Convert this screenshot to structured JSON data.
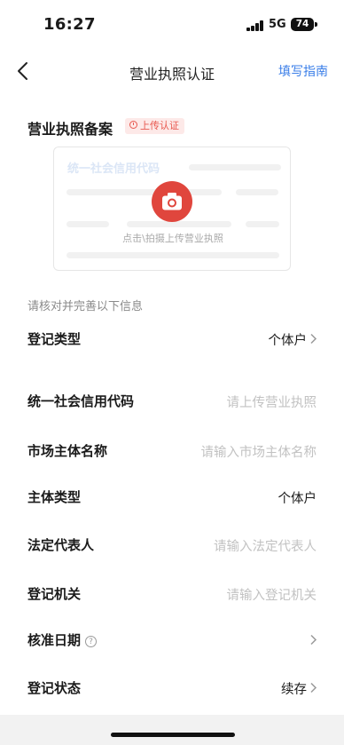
{
  "status_bar": {
    "time": "16:27",
    "network": "5G",
    "battery": "74"
  },
  "nav": {
    "title": "营业执照认证",
    "guide": "填写指南"
  },
  "license": {
    "title": "营业执照备案",
    "badge": "上传认证",
    "card_ghost_title": "统一社会信用代码",
    "card_hint": "点击\\拍摄上传营业执照"
  },
  "info_caption": "请核对并完善以下信息",
  "form": {
    "register_type": {
      "label": "登记类型",
      "value": "个体户"
    },
    "credit_code": {
      "label": "统一社会信用代码",
      "placeholder": "请上传营业执照"
    },
    "entity_name": {
      "label": "市场主体名称",
      "placeholder": "请输入市场主体名称"
    },
    "entity_type": {
      "label": "主体类型",
      "value": "个体户"
    },
    "legal_rep": {
      "label": "法定代表人",
      "placeholder": "请输入法定代表人"
    },
    "authority": {
      "label": "登记机关",
      "placeholder": "请输入登记机关"
    },
    "approval_date": {
      "label": "核准日期",
      "help": "?"
    },
    "register_status": {
      "label": "登记状态",
      "value": "续存"
    }
  },
  "colors": {
    "accent": "#3a7ee8",
    "camera": "#e0463d",
    "badge_text": "#e8584f",
    "badge_bg": "#fde9e8"
  },
  "icons": [
    "back-icon",
    "camera-icon",
    "clock-icon",
    "help-icon",
    "chevron-right-icon"
  ]
}
